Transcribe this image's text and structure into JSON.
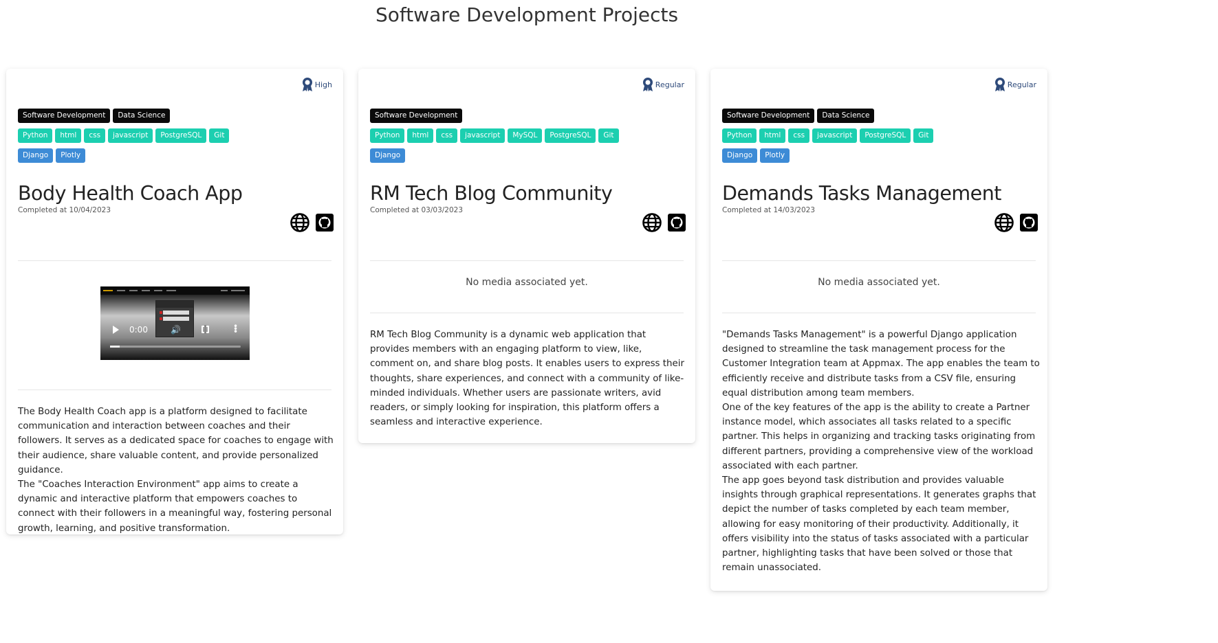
{
  "page": {
    "title": "Software Development Projects"
  },
  "projects": [
    {
      "rank": "High",
      "categories": [
        "Software Development",
        "Data Science"
      ],
      "technologies": [
        "Python",
        "html",
        "css",
        "javascript",
        "PostgreSQL",
        "Git"
      ],
      "frameworks": [
        "Django",
        "Plotly"
      ],
      "title": "Body Health Coach App",
      "completed": "Completed at 10/04/2023",
      "media": {
        "type": "video",
        "time": "0:00"
      },
      "description": [
        "The Body Health Coach app is a platform designed to facilitate communication and interaction between coaches and their followers. It serves as a dedicated space for coaches to engage with their audience, share valuable content, and provide personalized guidance.",
        "The \"Coaches Interaction Environment\" app aims to create a dynamic and interactive platform that empowers coaches to connect with their followers in a meaningful way, fostering personal growth, learning, and positive transformation."
      ]
    },
    {
      "rank": "Regular",
      "categories": [
        "Software Development"
      ],
      "technologies": [
        "Python",
        "html",
        "css",
        "javascript",
        "MySQL",
        "PostgreSQL",
        "Git"
      ],
      "frameworks": [
        "Django"
      ],
      "title": "RM Tech Blog Community",
      "completed": "Completed at 03/03/2023",
      "media": {
        "type": "none",
        "text": "No media associated yet."
      },
      "description": [
        "RM Tech Blog Community is a dynamic web application that provides members with an engaging platform to view, like, comment on, and share blog posts. It enables users to express their thoughts, share experiences, and connect with a community of like-minded individuals. Whether users are passionate writers, avid readers, or simply looking for inspiration, this platform offers a seamless and interactive experience."
      ]
    },
    {
      "rank": "Regular",
      "categories": [
        "Software Development",
        "Data Science"
      ],
      "technologies": [
        "Python",
        "html",
        "css",
        "javascript",
        "PostgreSQL",
        "Git"
      ],
      "frameworks": [
        "Django",
        "Plotly"
      ],
      "title": "Demands Tasks Management",
      "completed": "Completed at 14/03/2023",
      "media": {
        "type": "none",
        "text": "No media associated yet."
      },
      "description": [
        "\"Demands Tasks Management\" is a powerful Django application designed to streamline the task management process for the Customer Integration team at Appmax. The app enables the team to efficiently receive and distribute tasks from a CSV file, ensuring equal distribution among team members.",
        "One of the key features of the app is the ability to create a Partner instance model, which associates all tasks related to a specific partner. This helps in organizing and tracking tasks originating from different partners, providing a comprehensive view of the workload associated with each partner.",
        "The app goes beyond task distribution and provides valuable insights through graphical representations. It generates graphs that depict the number of tasks completed by each team member, allowing for easy monitoring of their productivity. Additionally, it offers visibility into the status of tasks associated with a particular partner, highlighting tasks that have been solved or those that remain unassociated."
      ]
    }
  ],
  "colors": {
    "category_tag": "#0a0a0a",
    "technology_tag": "#1ccfb0",
    "framework_tag": "#3d8bd6",
    "rank_icon": "#2e4a7a"
  },
  "icons": [
    "award-icon",
    "globe-icon",
    "github-icon"
  ]
}
